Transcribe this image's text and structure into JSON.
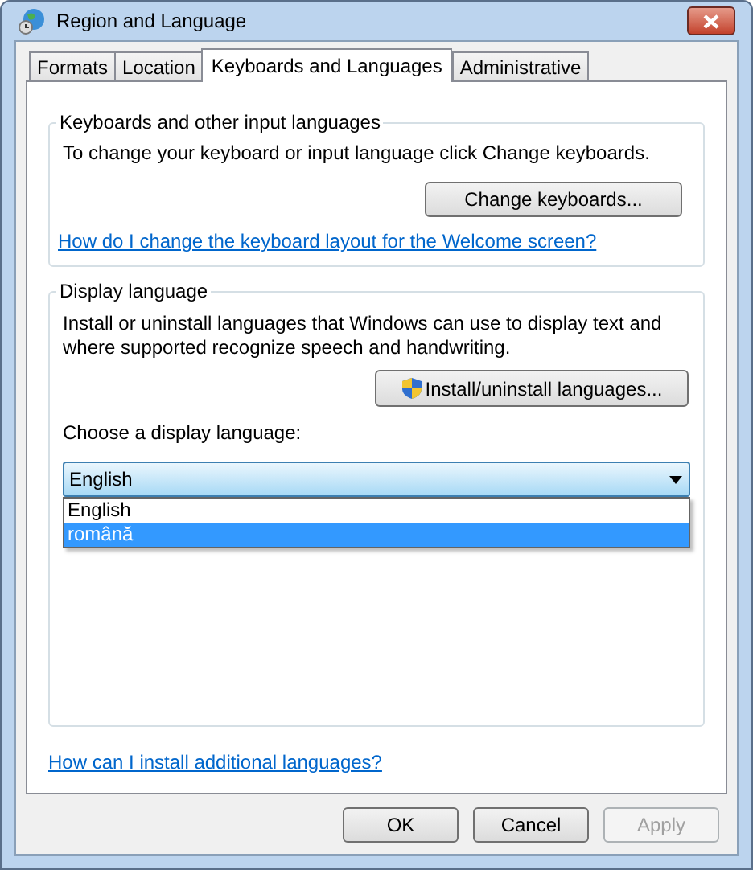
{
  "window": {
    "title": "Region and Language"
  },
  "tabs": [
    {
      "label": "Formats",
      "selected": false
    },
    {
      "label": "Location",
      "selected": false
    },
    {
      "label": "Keyboards and Languages",
      "selected": true
    },
    {
      "label": "Administrative",
      "selected": false
    }
  ],
  "keyboards_group": {
    "title": "Keyboards and other input languages",
    "description": "To change your keyboard or input language click Change keyboards.",
    "button": "Change keyboards...",
    "link": "How do I change the keyboard layout for the Welcome screen?"
  },
  "display_group": {
    "title": "Display language",
    "description": "Install or uninstall languages that Windows can use to display text and where supported recognize speech and handwriting.",
    "button": "Install/uninstall languages...",
    "choose_label": "Choose a display language:",
    "dropdown": {
      "value": "English",
      "expanded": true,
      "options": [
        {
          "label": "English",
          "highlighted": false
        },
        {
          "label": "română",
          "highlighted": true
        }
      ]
    }
  },
  "footer_link": "How can I install additional languages?",
  "buttons": [
    {
      "label": "OK",
      "disabled": false
    },
    {
      "label": "Cancel",
      "disabled": false
    },
    {
      "label": "Apply",
      "disabled": true
    }
  ]
}
